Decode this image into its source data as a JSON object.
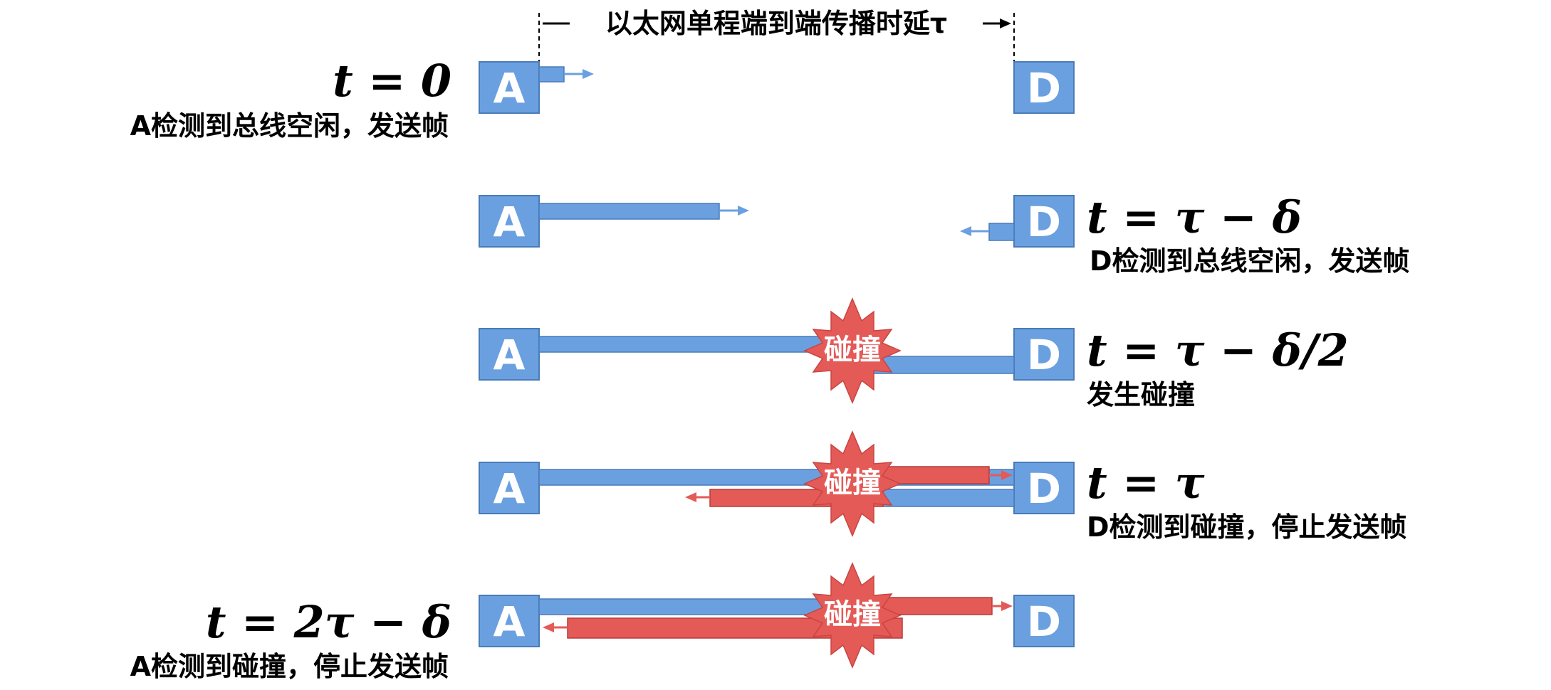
{
  "header": {
    "propagation_label": "以太网单程端到端传播时延τ"
  },
  "nodes": {
    "a_label": "A",
    "d_label": "D"
  },
  "collision_label": "碰撞",
  "stages": [
    {
      "time": "t = 0",
      "description": "A检测到总线空闲，发送帧"
    },
    {
      "time": "t = τ − δ",
      "description": "D检测到总线空闲，发送帧"
    },
    {
      "time": "t = τ − δ/2",
      "description": "发生碰撞"
    },
    {
      "time": "t = τ",
      "description": "D检测到碰撞，停止发送帧"
    },
    {
      "time": "t = 2τ − δ",
      "description": "A检测到碰撞，停止发送帧"
    }
  ],
  "colors": {
    "frame_a": "#6aa0e0",
    "frame_d": "#e45a57",
    "text": "#000000"
  }
}
